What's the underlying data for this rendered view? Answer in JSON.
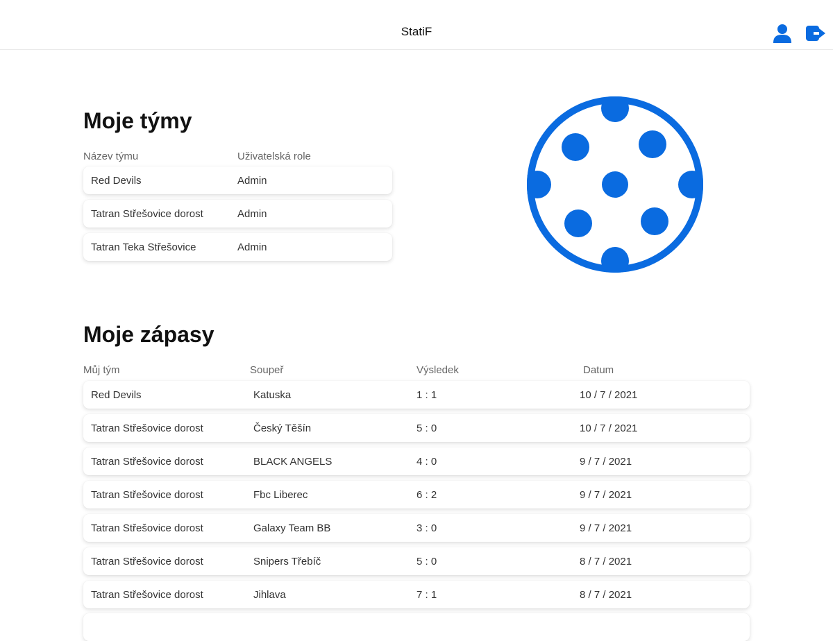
{
  "app": {
    "title": "StatiF",
    "accent_color": "#0a6be0"
  },
  "header": {
    "icons": [
      "user-icon",
      "logout-icon"
    ]
  },
  "teams": {
    "title": "Moje týmy",
    "columns": [
      "Název týmu",
      "Uživatelská role"
    ],
    "rows": [
      {
        "team": "Red Devils",
        "role": "Admin"
      },
      {
        "team": "Tatran Střešovice dorost",
        "role": "Admin"
      },
      {
        "team": "Tatran Teka Střešovice",
        "role": "Admin"
      }
    ]
  },
  "logo": {
    "icon": "floorball-icon"
  },
  "matches": {
    "title": "Moje zápasy",
    "columns": [
      "Můj tým",
      "Soupeř",
      "Výsledek",
      "Datum"
    ],
    "rows": [
      {
        "team": "Red Devils",
        "opponent": "Katuska",
        "result": "1 : 1",
        "date": "10 / 7 / 2021"
      },
      {
        "team": "Tatran Střešovice dorost",
        "opponent": "Český Těšín",
        "result": "5 : 0",
        "date": "10 / 7 / 2021"
      },
      {
        "team": "Tatran Střešovice dorost",
        "opponent": "BLACK ANGELS",
        "result": "4 : 0",
        "date": "9 / 7 / 2021"
      },
      {
        "team": "Tatran Střešovice dorost",
        "opponent": "Fbc Liberec",
        "result": "6 : 2",
        "date": "9 / 7 / 2021"
      },
      {
        "team": "Tatran Střešovice dorost",
        "opponent": "Galaxy Team BB",
        "result": "3 : 0",
        "date": "9 / 7 / 2021"
      },
      {
        "team": "Tatran Střešovice dorost",
        "opponent": "Snipers Třebíč",
        "result": "5 : 0",
        "date": "8 / 7 / 2021"
      },
      {
        "team": "Tatran Střešovice dorost",
        "opponent": "Jihlava",
        "result": "7 : 1",
        "date": "8 / 7 / 2021"
      }
    ]
  }
}
